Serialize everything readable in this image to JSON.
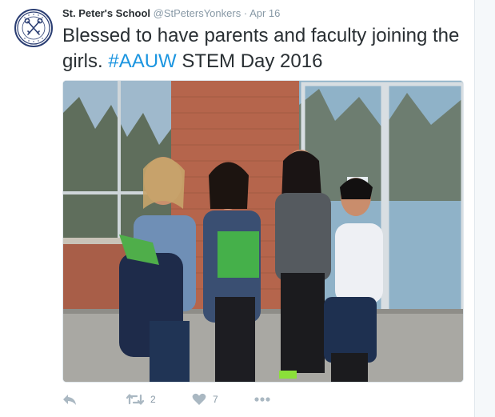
{
  "account": {
    "name": "St. Peter's School",
    "handle": "@StPetersYonkers",
    "separator": "·",
    "time": "Apr 16"
  },
  "tweet": {
    "text_before": "Blessed to have parents and faculty joining the girls.  ",
    "hashtag": "#AAUW",
    "text_after": " STEM Day 2016"
  },
  "actions": {
    "reply": "",
    "retweet_count": "2",
    "like_count": "7"
  },
  "colors": {
    "link": "#1b95e0",
    "muted": "#8899a6",
    "text": "#292f33"
  },
  "icons": {
    "reply": "reply-icon",
    "retweet": "retweet-icon",
    "like": "heart-icon",
    "more": "more-icon"
  }
}
